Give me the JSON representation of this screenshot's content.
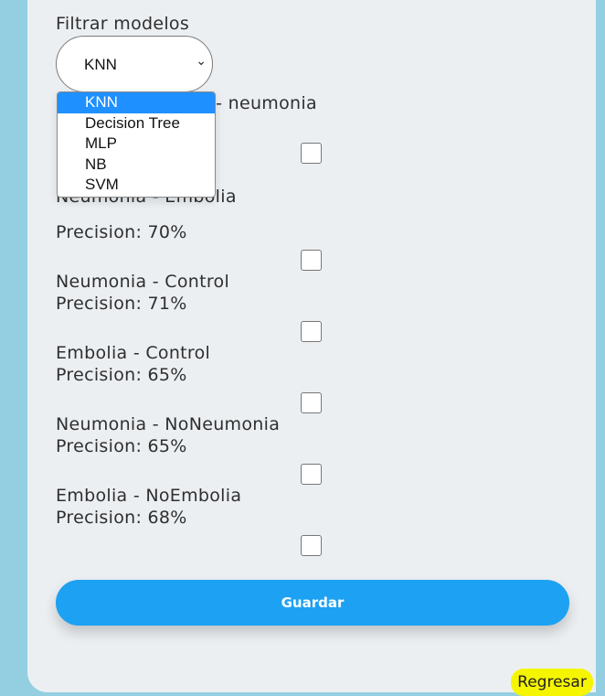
{
  "filter": {
    "label": "Filtrar modelos",
    "selected": "KNN",
    "options": [
      "KNN",
      "Decision Tree",
      "MLP",
      "NB",
      "SVM"
    ]
  },
  "models": [
    {
      "name": "Control - embolia - neumonia"
    },
    {
      "name": "Neumonia - Embolia",
      "precision": "Precision: 70%"
    },
    {
      "name": "Neumonia - Control",
      "precision": "Precision: 71%"
    },
    {
      "name": "Embolia - Control",
      "precision": "Precision: 65%"
    },
    {
      "name": "Neumonia - NoNeumonia",
      "precision": "Precision: 65%"
    },
    {
      "name": "Embolia - NoEmbolia",
      "precision": "Precision: 68%"
    }
  ],
  "actions": {
    "save": "Guardar",
    "back": "Regresar"
  },
  "colors": {
    "save": "#1da1f2",
    "back": "#f5f500",
    "page": "#93cfe0",
    "card": "#eceff2"
  }
}
